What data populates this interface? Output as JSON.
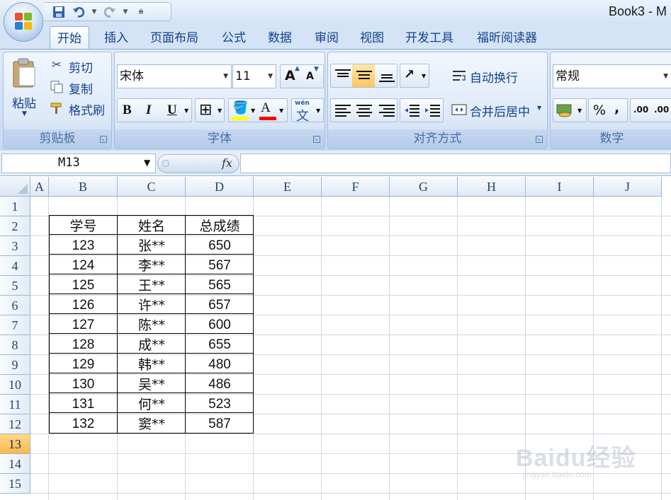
{
  "window": {
    "title": "Book3 - M"
  },
  "qat": {
    "save_icon": "save-icon",
    "undo_icon": "undo-icon",
    "redo_icon": "redo-icon"
  },
  "tabs": [
    {
      "label": "开始",
      "active": true
    },
    {
      "label": "插入"
    },
    {
      "label": "页面布局"
    },
    {
      "label": "公式"
    },
    {
      "label": "数据"
    },
    {
      "label": "审阅"
    },
    {
      "label": "视图"
    },
    {
      "label": "开发工具"
    },
    {
      "label": "福昕阅读器"
    }
  ],
  "ribbon": {
    "clipboard": {
      "label": "剪贴板",
      "paste": "粘贴",
      "cut": "剪切",
      "copy": "复制",
      "format_painter": "格式刷"
    },
    "font": {
      "label": "字体",
      "font_name": "宋体",
      "font_size": "11",
      "bold": "B",
      "italic": "I",
      "underline": "U",
      "grow": "A",
      "shrink": "A",
      "wen": "wén"
    },
    "alignment": {
      "label": "对齐方式",
      "wrap_text": "自动换行",
      "merge_center": "合并后居中"
    },
    "number": {
      "label": "数字",
      "format": "常规",
      "percent": "%",
      "comma": ",",
      "dec_inc": ".00",
      "dec_dec": ".00"
    }
  },
  "formula_bar": {
    "name_box": "M13",
    "fx": "fx",
    "value": ""
  },
  "grid": {
    "columns": [
      "A",
      "B",
      "C",
      "D",
      "E",
      "F",
      "G",
      "H",
      "I",
      "J"
    ],
    "rows": [
      "1",
      "2",
      "3",
      "4",
      "5",
      "6",
      "7",
      "8",
      "9",
      "10",
      "11",
      "12",
      "13",
      "14",
      "15"
    ],
    "selected_row": "13",
    "table": {
      "headers": [
        "学号",
        "姓名",
        "总成绩"
      ],
      "rows": [
        [
          "123",
          "张**",
          "650"
        ],
        [
          "124",
          "李**",
          "567"
        ],
        [
          "125",
          "王**",
          "565"
        ],
        [
          "126",
          "许**",
          "657"
        ],
        [
          "127",
          "陈**",
          "600"
        ],
        [
          "128",
          "成**",
          "655"
        ],
        [
          "129",
          "韩**",
          "480"
        ],
        [
          "130",
          "吴**",
          "486"
        ],
        [
          "131",
          "何**",
          "523"
        ],
        [
          "132",
          "窦**",
          "587"
        ]
      ]
    }
  },
  "watermark": {
    "logo": "Baidu经验",
    "sub": "jingyan.baidu.com"
  },
  "colors": {
    "ribbon": "#c6d9f1",
    "accent": "#15428b",
    "selected_row": "#f9b94a"
  }
}
